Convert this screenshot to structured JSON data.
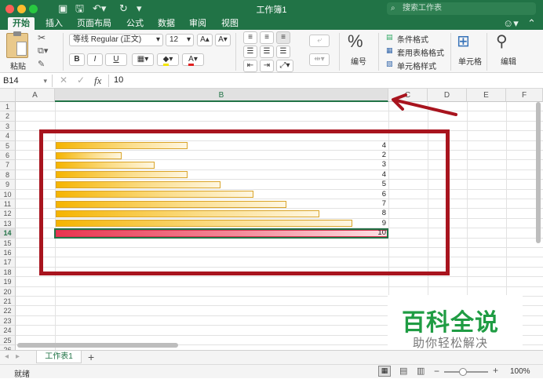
{
  "window": {
    "title": "工作簿1",
    "search_placeholder": "搜索工作表"
  },
  "tabs": [
    "开始",
    "插入",
    "页面布局",
    "公式",
    "数据",
    "审阅",
    "视图"
  ],
  "ribbon": {
    "paste": "粘贴",
    "font_name": "等线 Regular (正文)",
    "font_size": "12",
    "bold": "B",
    "italic": "I",
    "underline": "U",
    "number_label": "编号",
    "conditional_format": "条件格式",
    "table_format": "套用表格格式",
    "cell_style": "单元格样式",
    "cells": "单元格",
    "edit": "编辑"
  },
  "formula_bar": {
    "cell_ref": "B14",
    "fx": "fx",
    "value": "10"
  },
  "columns": [
    "A",
    "B",
    "C",
    "D",
    "E",
    "F"
  ],
  "rows": [
    "1",
    "2",
    "3",
    "4",
    "5",
    "6",
    "7",
    "8",
    "9",
    "10",
    "11",
    "12",
    "13",
    "14",
    "15",
    "16",
    "17",
    "18",
    "19",
    "20",
    "21",
    "22",
    "23",
    "24",
    "25",
    "26"
  ],
  "data_values": [
    {
      "row": 5,
      "value": "4",
      "fill": 0.4
    },
    {
      "row": 6,
      "value": "2",
      "fill": 0.2
    },
    {
      "row": 7,
      "value": "3",
      "fill": 0.3
    },
    {
      "row": 8,
      "value": "4",
      "fill": 0.4
    },
    {
      "row": 9,
      "value": "5",
      "fill": 0.5
    },
    {
      "row": 10,
      "value": "6",
      "fill": 0.6
    },
    {
      "row": 11,
      "value": "7",
      "fill": 0.7
    },
    {
      "row": 12,
      "value": "8",
      "fill": 0.8
    },
    {
      "row": 13,
      "value": "9",
      "fill": 0.9
    },
    {
      "row": 14,
      "value": "10",
      "fill": 1.0
    }
  ],
  "sheet_tab": "工作表1",
  "add_sheet": "+",
  "status": "就绪",
  "zoom": "100%",
  "watermark": {
    "title": "百科全说",
    "subtitle": "助你轻松解决"
  },
  "colors": {
    "accent": "#217346",
    "bar": "#f5b400",
    "bar_highlight": "#e8354f",
    "annotation": "#a8141e"
  }
}
